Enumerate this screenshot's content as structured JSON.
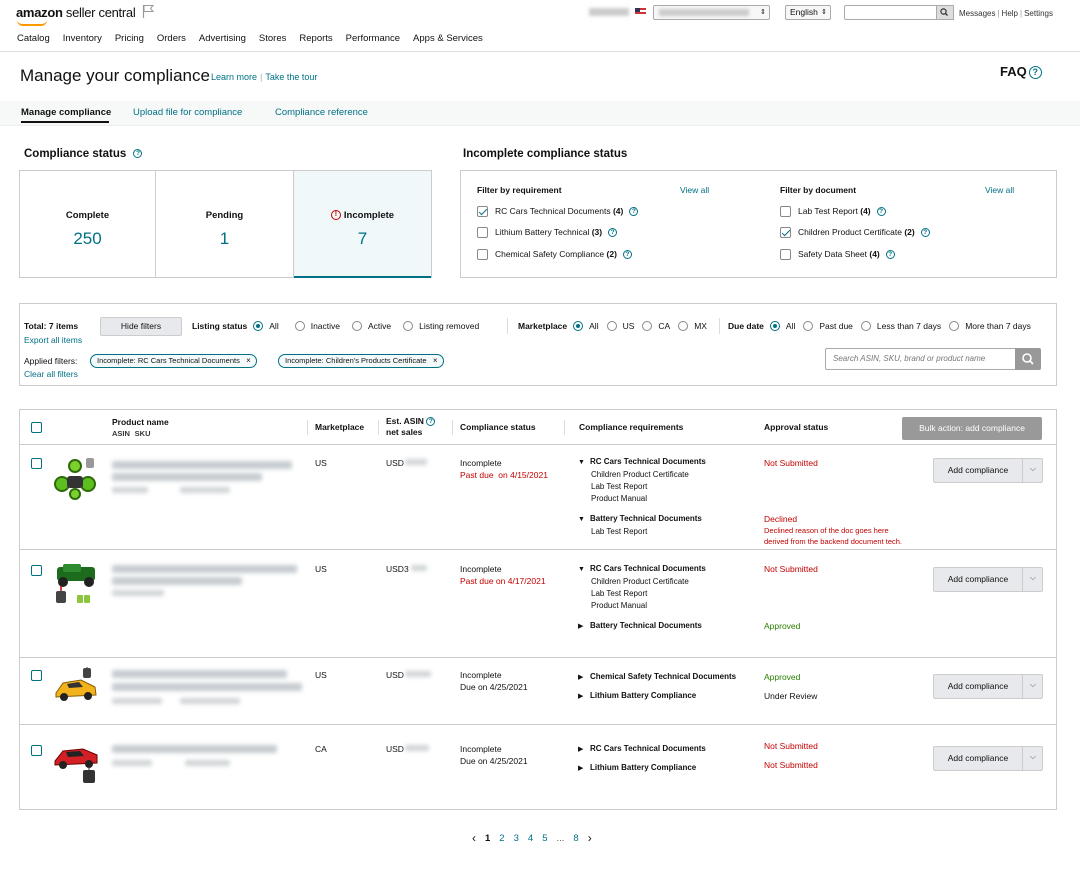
{
  "header": {
    "logo_brand": "amazon",
    "logo_product": "seller central",
    "language": "English",
    "links": [
      "Messages",
      "Help",
      "Settings"
    ],
    "nav": [
      "Catalog",
      "Inventory",
      "Pricing",
      "Orders",
      "Advertising",
      "Stores",
      "Reports",
      "Performance",
      "Apps & Services"
    ]
  },
  "page": {
    "title": "Manage your compliance",
    "learn_more": "Learn more",
    "take_tour": "Take the tour",
    "faq": "FAQ"
  },
  "tabs": [
    "Manage compliance",
    "Upload file for compliance",
    "Compliance reference"
  ],
  "compliance_status": {
    "title": "Compliance status",
    "cards": [
      {
        "label": "Complete",
        "value": "250"
      },
      {
        "label": "Pending",
        "value": "1"
      },
      {
        "label": "Incomplete",
        "value": "7"
      }
    ]
  },
  "incomplete_status": {
    "title": "Incomplete compliance status",
    "by_requirement": {
      "title": "Filter by requirement",
      "view_all": "View all",
      "items": [
        {
          "label": "RC Cars Technical Documents",
          "count": "(4)",
          "checked": true
        },
        {
          "label": "Lithium Battery Technical",
          "count": "(3)",
          "checked": false
        },
        {
          "label": "Chemical Safety Compliance",
          "count": "(2)",
          "checked": false
        }
      ]
    },
    "by_document": {
      "title": "Filter by document",
      "view_all": "View all",
      "items": [
        {
          "label": "Lab Test Report",
          "count": "(4)",
          "checked": false
        },
        {
          "label": "Children Product Certificate",
          "count": "(2)",
          "checked": true
        },
        {
          "label": "Safety Data Sheet",
          "count": "(4)",
          "checked": false
        }
      ]
    }
  },
  "filters": {
    "total": "Total: 7 items",
    "export": "Export all items",
    "hide_filters": "Hide filters",
    "listing_status": {
      "label": "Listing status",
      "options": [
        "All",
        "Inactive",
        "Active",
        "Listing removed"
      ],
      "selected": 0
    },
    "marketplace": {
      "label": "Marketplace",
      "options": [
        "All",
        "US",
        "CA",
        "MX"
      ],
      "selected": 0
    },
    "due_date": {
      "label": "Due date",
      "options": [
        "All",
        "Past due",
        "Less than 7 days",
        "More than 7 days"
      ],
      "selected": 0
    },
    "applied_label": "Applied filters:",
    "clear_all": "Clear all filters",
    "chips": [
      "Incomplete: RC Cars Technical Documents",
      "Incomplete: Children's Products Certificate"
    ],
    "search_placeholder": "Search ASIN, SKU, brand or product name"
  },
  "table": {
    "headers": {
      "product_name": "Product name",
      "asin": "ASIN",
      "sku": "SKU",
      "marketplace": "Marketplace",
      "est_asin": "Est. ASIN",
      "net_sales": "net sales",
      "compliance_status": "Compliance status",
      "requirements": "Compliance requirements",
      "approval": "Approval status"
    },
    "bulk_action": "Bulk action: add compliance",
    "add_label": "Add compliance",
    "rows": [
      {
        "marketplace": "US",
        "sales": "USD",
        "status": "Incomplete",
        "due": "Past due",
        "due_date": "on 4/15/2021",
        "requirements": [
          {
            "title": "RC Cars Technical Documents",
            "docs": [
              "Children Product Certificate",
              "Lab Test Report",
              "Product Manual"
            ],
            "approval": "Not Submitted"
          },
          {
            "title": "Battery Technical Documents",
            "docs": [
              "Lab Test Report"
            ],
            "approval": "Declined",
            "note1": "Declined reason of the doc goes here",
            "note2": "derived from the backend document tech."
          }
        ]
      },
      {
        "marketplace": "US",
        "sales": "USD3",
        "status": "Incomplete",
        "due": "Past due on 4/17/2021",
        "requirements": [
          {
            "title": "RC Cars Technical Documents",
            "docs": [
              "Children Product Certificate",
              "Lab Test Report",
              "Product Manual"
            ],
            "approval": "Not Submitted"
          },
          {
            "title": "Battery Technical Documents",
            "docs": [],
            "approval": "Approved"
          }
        ]
      },
      {
        "marketplace": "US",
        "sales": "USD",
        "status": "Incomplete",
        "due": "Due on 4/25/2021",
        "requirements": [
          {
            "title": "Chemical Safety Technical Documents",
            "docs": [],
            "approval": "Approved"
          },
          {
            "title": "Lithium Battery Compliance",
            "docs": [],
            "approval": "Under Review"
          }
        ]
      },
      {
        "marketplace": "CA",
        "sales": "USD",
        "status": "Incomplete",
        "due": "Due on 4/25/2021",
        "requirements": [
          {
            "title": "RC Cars Technical Documents",
            "docs": [],
            "approval": "Not Submitted"
          },
          {
            "title": "Lithium Battery Compliance",
            "docs": [],
            "approval": "Not Submitted"
          }
        ]
      }
    ]
  },
  "pagination": {
    "pages": [
      "1",
      "2",
      "3",
      "4",
      "5",
      "...",
      "8"
    ],
    "current": "1"
  },
  "colors": {
    "link": "#007185",
    "error": "#c40000",
    "success": "#2a7d00",
    "accent": "#ff9900"
  }
}
